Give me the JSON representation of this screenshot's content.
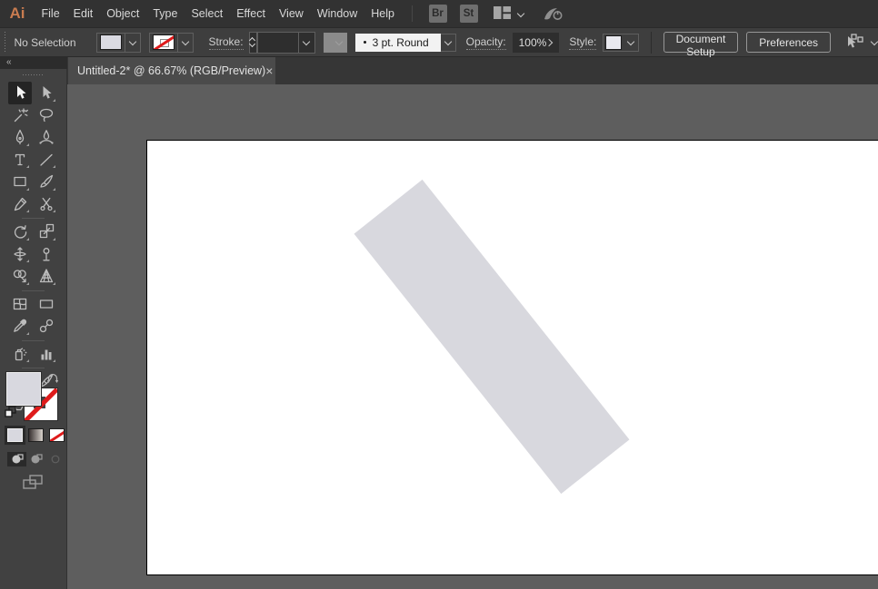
{
  "menubar": {
    "logo": "Ai",
    "items": [
      "File",
      "Edit",
      "Object",
      "Type",
      "Select",
      "Effect",
      "View",
      "Window",
      "Help"
    ],
    "bridge_button": "Br",
    "stock_button": "St"
  },
  "controlbar": {
    "selection_status": "No Selection",
    "stroke_label": "Stroke:",
    "brush_definition": "3 pt. Round",
    "opacity_label": "Opacity:",
    "opacity_value": "100%",
    "style_label": "Style:",
    "document_setup_button": "Document Setup",
    "preferences_button": "Preferences"
  },
  "tab": {
    "title": "Untitled-2* @ 66.67% (RGB/Preview)",
    "close_glyph": "×"
  },
  "toolbar": {
    "collapse_glyph": "«",
    "active_tool": "selection",
    "tools": [
      "selection",
      "direct-selection",
      "magic-wand",
      "lasso",
      "pen",
      "curvature",
      "type",
      "line-segment",
      "rectangle",
      "paintbrush",
      "shaper",
      "scissors",
      "rotate",
      "scale",
      "width",
      "puppet-warp",
      "shape-builder",
      "perspective-grid",
      "mesh",
      "gradient",
      "eyedropper",
      "blend",
      "symbol-sprayer",
      "column-graph",
      "artboard",
      "slice",
      "hand",
      "zoom"
    ]
  },
  "colors": {
    "logo_accent": "#c97c50",
    "pasteboard": "#5e5e5e",
    "artboard": "#ffffff",
    "none_slash_red": "#de1b1b"
  },
  "canvas": {
    "shape": {
      "type": "rotated-rectangle",
      "fill": "#d8d8de",
      "rotation_deg": 51.5
    }
  }
}
